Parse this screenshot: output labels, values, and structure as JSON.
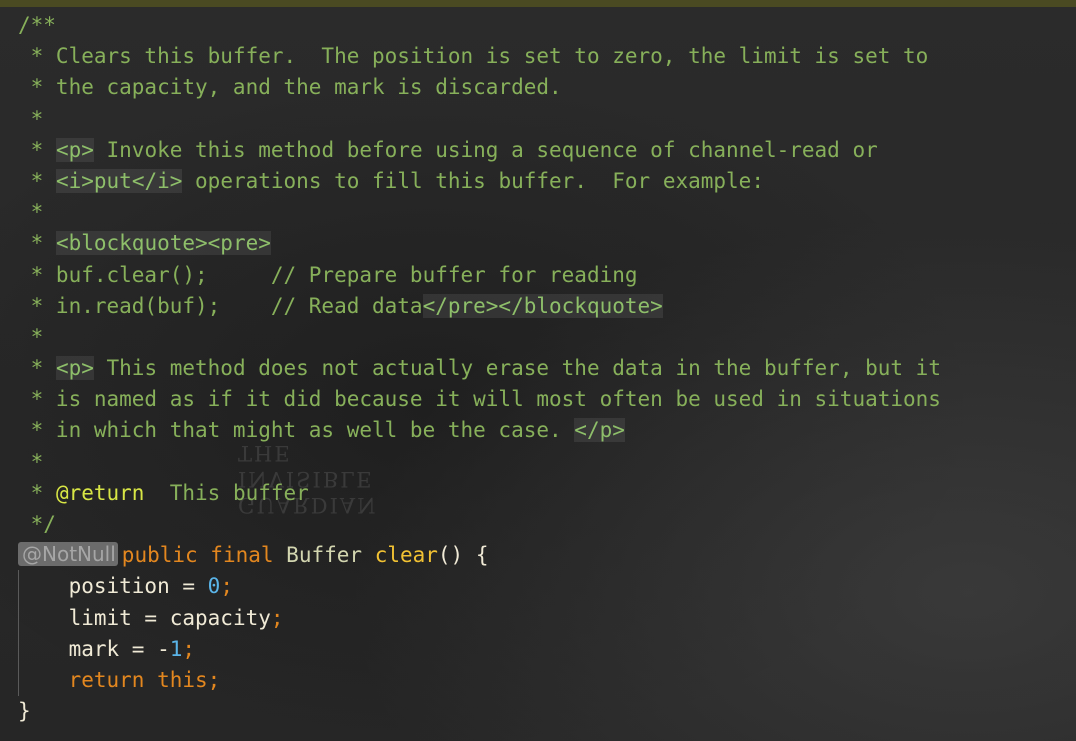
{
  "watermark": {
    "line1": "THE",
    "line2": "INVISIBLE",
    "line3": "GUARDIAN"
  },
  "doc": {
    "open": "/**",
    "l1": " * Clears this buffer.  The position is set to zero, the limit is set to",
    "l2": " * the capacity, and the mark is discarded.",
    "star": " *",
    "star_sp": " * ",
    "p_tag": "<p>",
    "l4_text": " Invoke this method before using a sequence of channel-read or",
    "i_open": "<i>",
    "i_word": "put",
    "i_close": "</i>",
    "l5_text": " operations to fill this buffer.  For example:",
    "blockquote_pre": "<blockquote><pre>",
    "l8": " * buf.clear();     // Prepare buffer for reading",
    "l9_prefix": " * in.read(buf);    // Read data",
    "pre_close": "</pre></blockquote>",
    "l11_text": " This method does not actually erase the data in the buffer, but it",
    "l12": " * is named as if it did because it will most often be used in situations",
    "l13_prefix": " * in which that might as well be the case. ",
    "p_close": "</p>",
    "return_tag": "@return",
    "return_text": "  This buffer",
    "close": " */"
  },
  "code": {
    "annotation": "@NotNull",
    "kw_public_final": "public final",
    "space": " ",
    "type": "Buffer",
    "method": "clear",
    "sig_rest": "() {",
    "indent": "    ",
    "position": "position = ",
    "zero": "0",
    "semi": ";",
    "limit": "limit = capacity",
    "mark": "mark = -",
    "one": "1",
    "return_stmt": "return this;",
    "close_brace": "}"
  }
}
